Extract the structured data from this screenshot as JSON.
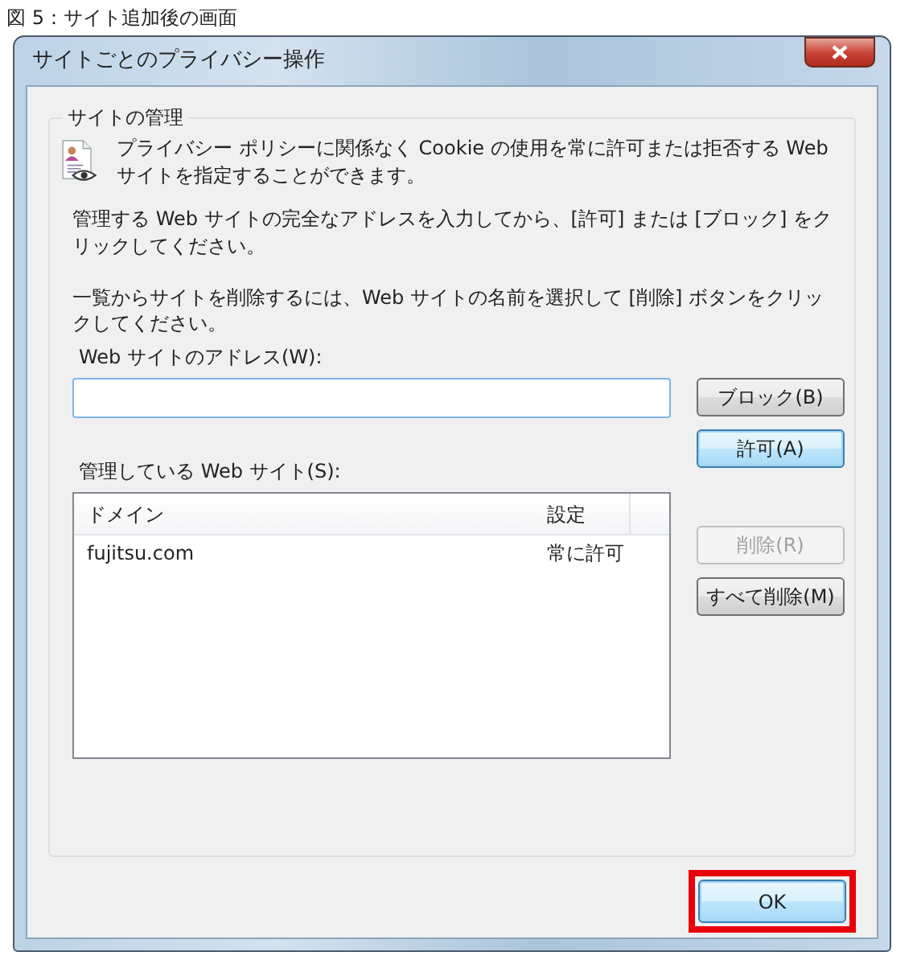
{
  "caption": "図 5：サイト追加後の画面",
  "window": {
    "title": "サイトごとのプライバシー操作"
  },
  "group": {
    "title": "サイトの管理",
    "intro": "プライバシー ポリシーに関係なく Cookie の使用を常に許可または拒否する Web サイトを指定することができます。",
    "instructions": [
      "管理する Web サイトの完全なアドレスを入力してから、[許可] または [ブロック] をクリックしてください。",
      "一覧からサイトを削除するには、Web サイトの名前を選択して [削除] ボタンをクリックしてください。"
    ],
    "address": {
      "label": "Web サイトのアドレス(W):",
      "focused": true
    },
    "address_buttons": [
      {
        "label": "ブロック(B)",
        "default": false,
        "disabled": false
      },
      {
        "label": "許可(A)",
        "default": true,
        "disabled": false
      }
    ],
    "sites": {
      "label": "管理している Web サイト(S):",
      "columns": [
        "ドメイン",
        "設定"
      ],
      "rows": [
        [
          "fujitsu.com",
          "常に許可"
        ]
      ]
    },
    "site_buttons": [
      {
        "label": "削除(R)",
        "default": false,
        "disabled": true
      },
      {
        "label": "すべて削除(M)",
        "default": false,
        "disabled": false
      }
    ]
  },
  "ok": {
    "label": "OK",
    "default": true,
    "highlighted": true
  }
}
